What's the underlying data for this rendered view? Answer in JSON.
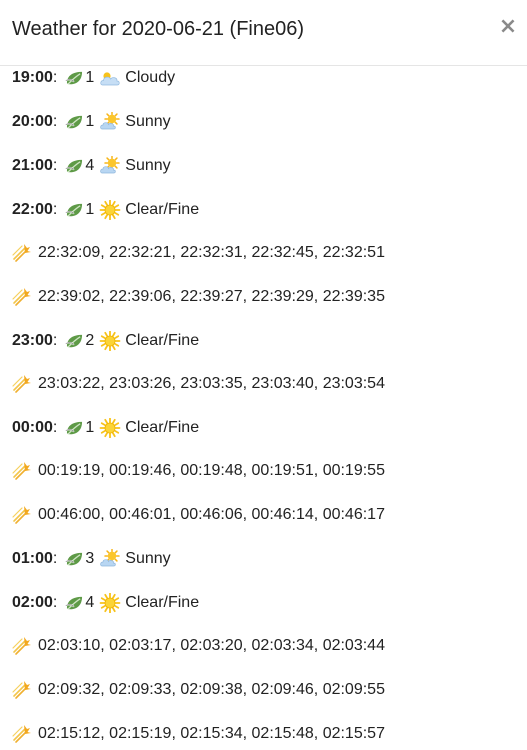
{
  "title": "Weather for 2020-06-21 (Fine06)",
  "close_icon": "×",
  "rows": [
    {
      "type": "hour",
      "time": "19:00",
      "colon": ":",
      "wind": "1",
      "condition": "Cloudy",
      "condition_icon": "cloudy-icon"
    },
    {
      "type": "hour",
      "time": "20:00",
      "colon": ":",
      "wind": "1",
      "condition": "Sunny",
      "condition_icon": "sunny-icon"
    },
    {
      "type": "hour",
      "time": "21:00",
      "colon": ":",
      "wind": "4",
      "condition": "Sunny",
      "condition_icon": "sunny-icon"
    },
    {
      "type": "hour",
      "time": "22:00",
      "colon": ":",
      "wind": "1",
      "condition": "Clear/Fine",
      "condition_icon": "sun-icon"
    },
    {
      "type": "stars",
      "times": "22:32:09, 22:32:21, 22:32:31, 22:32:45, 22:32:51"
    },
    {
      "type": "stars",
      "times": "22:39:02, 22:39:06, 22:39:27, 22:39:29, 22:39:35"
    },
    {
      "type": "hour",
      "time": "23:00",
      "colon": ":",
      "wind": "2",
      "condition": "Clear/Fine",
      "condition_icon": "sun-icon"
    },
    {
      "type": "stars",
      "times": "23:03:22, 23:03:26, 23:03:35, 23:03:40, 23:03:54"
    },
    {
      "type": "hour",
      "time": "00:00",
      "colon": ":",
      "wind": "1",
      "condition": "Clear/Fine",
      "condition_icon": "sun-icon"
    },
    {
      "type": "stars",
      "times": "00:19:19, 00:19:46, 00:19:48, 00:19:51, 00:19:55"
    },
    {
      "type": "stars",
      "times": "00:46:00, 00:46:01, 00:46:06, 00:46:14, 00:46:17"
    },
    {
      "type": "hour",
      "time": "01:00",
      "colon": ":",
      "wind": "3",
      "condition": "Sunny",
      "condition_icon": "sunny-icon"
    },
    {
      "type": "hour",
      "time": "02:00",
      "colon": ":",
      "wind": "4",
      "condition": "Clear/Fine",
      "condition_icon": "sun-icon"
    },
    {
      "type": "stars",
      "times": "02:03:10, 02:03:17, 02:03:20, 02:03:34, 02:03:44"
    },
    {
      "type": "stars",
      "times": "02:09:32, 02:09:33, 02:09:38, 02:09:46, 02:09:55"
    },
    {
      "type": "stars",
      "times": "02:15:12, 02:15:19, 02:15:34, 02:15:48, 02:15:57"
    }
  ],
  "colors": {
    "text": "#222222",
    "close": "#8a8a8a",
    "divider": "#e5e5e5",
    "sun": "#f5c518",
    "cloud": "#9fc4e8",
    "leaf": "#4f8a3c",
    "star": "#f2b233"
  }
}
